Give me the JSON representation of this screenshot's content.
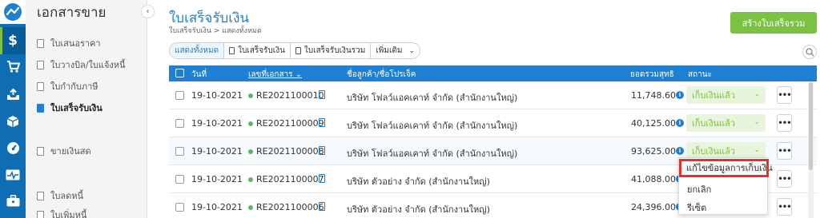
{
  "app": {
    "section_title": "เอกสารขาย",
    "collapse_glyph": "‹"
  },
  "rail": [
    {
      "icon": "dollar-icon",
      "glyph": "$"
    },
    {
      "icon": "cart-icon",
      "glyph": "🛒"
    },
    {
      "icon": "inbox-icon",
      "glyph": "⇪"
    },
    {
      "icon": "box-icon",
      "glyph": "▣"
    },
    {
      "icon": "gauge-icon",
      "glyph": "◔"
    },
    {
      "icon": "pulse-icon",
      "glyph": "∿"
    },
    {
      "icon": "briefcase-icon",
      "glyph": "▤"
    }
  ],
  "sidebar": {
    "items": [
      {
        "label": "ใบเสนอราคา"
      },
      {
        "label": "ใบวางบิล/ใบแจ้งหนี้"
      },
      {
        "label": "ใบกำกับภาษี"
      },
      {
        "label": "ใบเสร็จรับเงิน",
        "active": true
      },
      {
        "label": "ขายเงินสด"
      },
      {
        "label": "ใบลดหนี้"
      },
      {
        "label": "ใบเพิ่มหนี้"
      }
    ]
  },
  "header": {
    "title": "ใบเสร็จรับเงิน",
    "breadcrumb": "ใบเสร็จรับเงิน > แสดงทั้งหมด",
    "create_button": "สร้างใบเสร็จรวม"
  },
  "filters": {
    "all": "แสดงทั้งหมด",
    "receipt": "ใบเสร็จรับเงิน",
    "combined": "ใบเสร็จรับเงินรวม",
    "more": "เพิ่มเติม",
    "chevron": "⌄"
  },
  "table": {
    "headers": {
      "date": "วันที่",
      "doc_no": "เลขที่เอกสาร ⌄",
      "customer": "ชื่อลูกค้า/ชื่อโปรเจ็ค",
      "net_total": "ยอดรวมสุทธิ",
      "status": "สถานะ"
    },
    "rows": [
      {
        "date": "19-10-2021",
        "doc_no": "RE2021100010",
        "customer": "บริษัท โฟลว์แอคเคาท์ จำกัด (สำนักงานใหญ่)",
        "amount": "11,748.60",
        "status": "เก็บเงินแล้ว"
      },
      {
        "date": "19-10-2021",
        "doc_no": "RE2021100009",
        "customer": "บริษัท โฟลว์แอคเคาท์ จำกัด (สำนักงานใหญ่)",
        "amount": "40,125.00",
        "status": "เก็บเงินแล้ว"
      },
      {
        "date": "19-10-2021",
        "doc_no": "RE2021100008",
        "customer": "บริษัท โฟลว์แอคเคาท์ จำกัด (สำนักงานใหญ่)",
        "amount": "93,625.00",
        "status": "เก็บเงินแล้ว"
      },
      {
        "date": "19-10-2021",
        "doc_no": "RE2021100007",
        "customer": "บริษัท ตัวอย่าง จำกัด (สำนักงานใหญ่)",
        "amount": "41,088.00",
        "status": ""
      },
      {
        "date": "19-10-2021",
        "doc_no": "RE2021100006",
        "customer": "บริษัท ตัวอย่าง จำกัด (สำนักงานใหญ่)",
        "amount": "24,396.00",
        "status": ""
      }
    ],
    "info_glyph": "i",
    "more_glyph": "•••",
    "status_arrow": "⌄"
  },
  "dropdown": {
    "items": [
      "แก้ไขข้อมูลการเก็บเงิน",
      "ยกเลิก",
      "รีเซ็ต"
    ]
  },
  "colors": {
    "primary": "#1f7fd0",
    "rail": "#0f6db3",
    "accent_green": "#7bc142",
    "highlight_red": "#d9372b"
  }
}
